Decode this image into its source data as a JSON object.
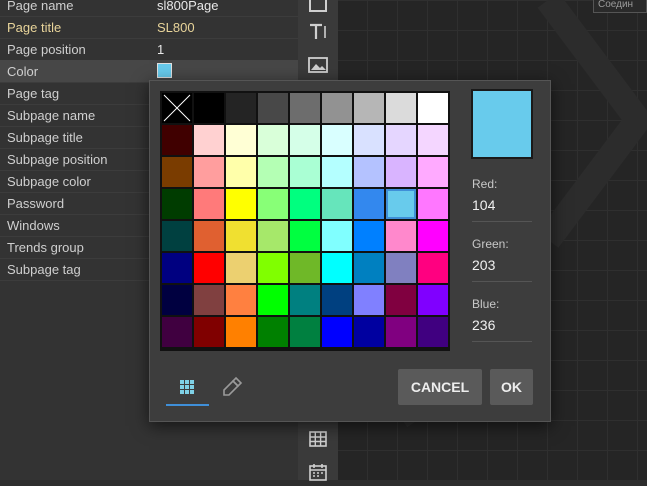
{
  "properties": [
    {
      "label": "Page name",
      "value": "sl800Page"
    },
    {
      "label": "Page title",
      "value": "SL800",
      "highlight": true
    },
    {
      "label": "Page position",
      "value": "1"
    },
    {
      "label": "Color",
      "swatch": "#68cbec",
      "selected": true
    },
    {
      "label": "Page tag",
      "value": ""
    },
    {
      "label": "Subpage name",
      "value": ""
    },
    {
      "label": "Subpage title",
      "value": ""
    },
    {
      "label": "Subpage position",
      "value": ""
    },
    {
      "label": "Subpage color",
      "value": ""
    },
    {
      "label": "Password",
      "value": ""
    },
    {
      "label": "Windows",
      "value": ""
    },
    {
      "label": "Trends group",
      "value": ""
    },
    {
      "label": "Subpage tag",
      "value": ""
    }
  ],
  "toolbar_icons": [
    "text-tool-icon",
    "image-tool-icon",
    "table-tool-icon",
    "calendar-tool-icon"
  ],
  "canvas_tab": "Соедин",
  "color_dialog": {
    "palette": [
      [
        "none",
        "#000000",
        "#242424",
        "#484848",
        "#6d6d6d",
        "#929292",
        "#b6b6b6",
        "#dbdbdb",
        "#ffffff"
      ],
      [
        "#400000",
        "#ffd1d1",
        "#ffffd5",
        "#d9ffd9",
        "#d5ffe8",
        "#d9ffff",
        "#d9e1ff",
        "#e5d6ff",
        "#f4d6ff"
      ],
      [
        "#7a3c00",
        "#ff9e9e",
        "#ffffaa",
        "#b4ffb4",
        "#aaffd4",
        "#b4ffff",
        "#b4c2ff",
        "#d9b4ff",
        "#ffaaff"
      ],
      [
        "#003c00",
        "#ff7a7a",
        "#ffff00",
        "#88ff77",
        "#00ff7f",
        "#66e5bb",
        "#3388ee",
        "#68cbec",
        "#ff77ff"
      ],
      [
        "#004040",
        "#e06030",
        "#f0e030",
        "#a6e86a",
        "#00ff40",
        "#80ffff",
        "#0080ff",
        "#ff88cc",
        "#ff00ff"
      ],
      [
        "#000080",
        "#ff0000",
        "#ecd070",
        "#80ff00",
        "#6fb828",
        "#00ffff",
        "#0080c0",
        "#8080c0",
        "#ff0080"
      ],
      [
        "#000040",
        "#804040",
        "#ff8040",
        "#00ff00",
        "#008080",
        "#004080",
        "#8080ff",
        "#800040",
        "#8000ff"
      ],
      [
        "#400040",
        "#800000",
        "#ff8000",
        "#008000",
        "#008040",
        "#0000ff",
        "#0000a0",
        "#800080",
        "#400080"
      ]
    ],
    "selected_row": 3,
    "selected_col": 7,
    "preview_color": "#68cbec",
    "red_label": "Red:",
    "red_value": "104",
    "green_label": "Green:",
    "green_value": "203",
    "blue_label": "Blue:",
    "blue_value": "236",
    "cancel_label": "CANCEL",
    "ok_label": "OK"
  }
}
